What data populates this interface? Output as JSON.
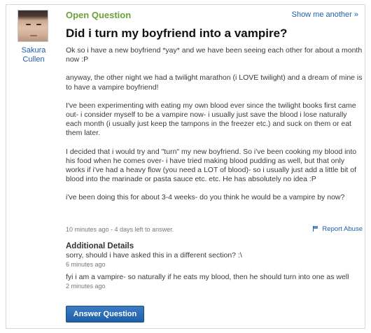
{
  "asker": {
    "name": "Sakura Cullen"
  },
  "header": {
    "status_label": "Open Question",
    "show_another": "Show me another »"
  },
  "question": {
    "title": "Did i turn my boyfriend into a vampire?",
    "paragraphs": [
      "Ok so i have a new boyfriend *yay* and we have been seeing each other for about a month now :P",
      "anyway, the other night we had a twilight marathon (i LOVE twilight) and a dream of mine is to have a vampire boyfriend!",
      "I've been experimenting with eating my own blood ever since the twilight books first came out- i consider myself to be a vampire now- i usually just save the blood i lose naturally each month (i usually just keep the tampons in the freezer etc.) and suck on them or eat them later.",
      "I decided that i would try and \"turn\" my new boyfriend. So i've been cooking my blood into his food when he comes over- i have tried making blood pudding as well, but that only works if i've had a heavy flow (you need a LOT of blood)- so i usually just add a little bit of blood into the marinade or pasta sauce etc. etc. He has absolutely no idea :P",
      "i've been doing this for about 3-4 weeks- do you think he would be a vampire by now?"
    ],
    "meta": "10 minutes ago - 4 days left to answer.",
    "report_label": "Report Abuse"
  },
  "additional_details": {
    "heading": "Additional Details",
    "items": [
      {
        "text": "sorry, should i have asked this in a different section? :\\",
        "time": "6 minutes ago"
      },
      {
        "text": "fyi i am a vampire- so naturally if he eats my blood, then he should turn into one as well",
        "time": "2 minutes ago"
      }
    ]
  },
  "actions": {
    "answer_label": "Answer Question"
  },
  "colors": {
    "status_green": "#6ba13a",
    "link_blue": "#1f5fa8",
    "button_blue": "#1f5fa8"
  }
}
